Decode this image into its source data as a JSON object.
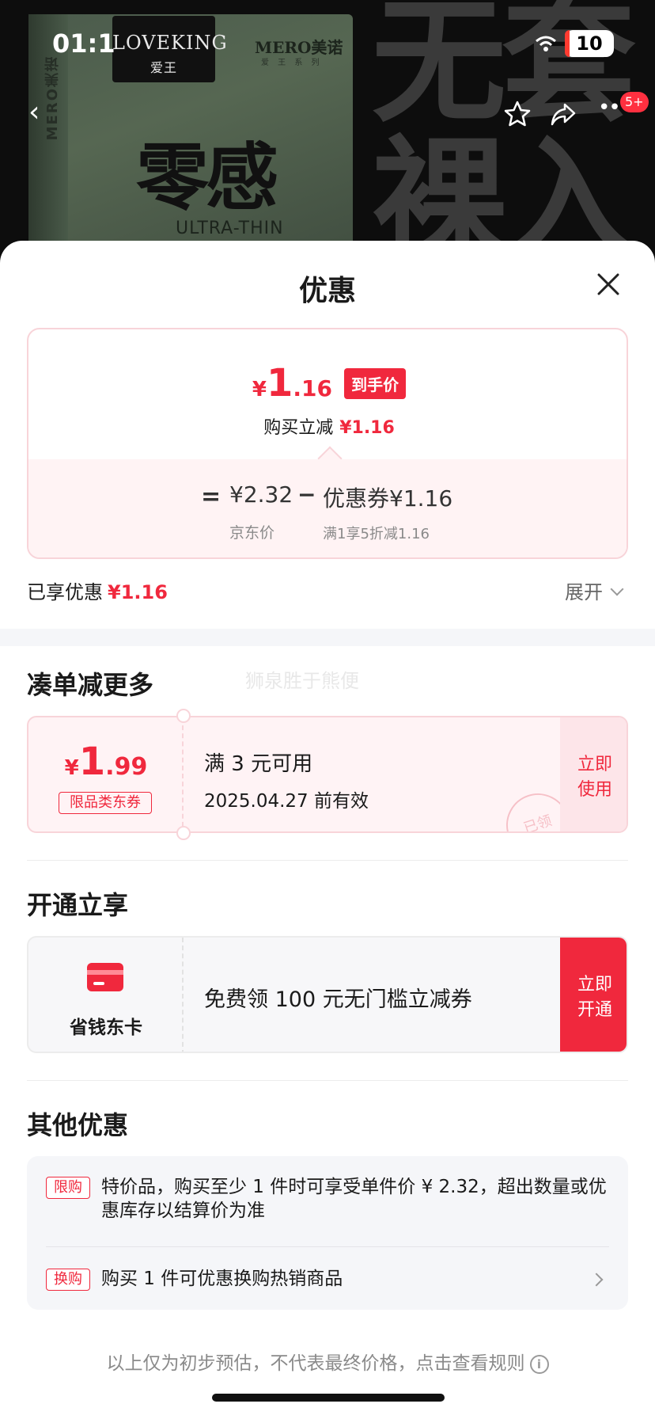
{
  "background": {
    "brand_badge_top": "LOVEKING",
    "brand_badge_bottom": "爱王",
    "mero_brand": "MERO美诺",
    "mero_sub": "爱 王 系 列",
    "product_name": "零感",
    "product_en": "ULTRA-THIN",
    "side_text": "MERO美诺",
    "overlay_line1": "无套",
    "overlay_line2": "裸入"
  },
  "status_bar": {
    "time": "01:1",
    "battery": "10"
  },
  "top_nav": {
    "more_badge": "5+"
  },
  "sheet": {
    "title": "优惠"
  },
  "price_card": {
    "final_currency": "¥",
    "final_int": "1",
    "final_dec": ".16",
    "final_tag": "到手价",
    "buy_reduce_label": "购买立减",
    "buy_reduce_amount": "¥1.16",
    "equals": "=",
    "jd_price": "¥2.32",
    "minus": "−",
    "coupon_amount": "优惠券¥1.16",
    "jd_price_label": "京东价",
    "coupon_desc": "满1享5折减1.16"
  },
  "enjoyed": {
    "label": "已享优惠",
    "amount": "¥1.16",
    "expand_label": "展开"
  },
  "section_more": {
    "title": "凑单减更多",
    "watermark": "狮泉胜于熊便",
    "coupon": {
      "currency": "¥",
      "int": "1",
      "dec": ".99",
      "tag": "限品类东券",
      "condition": "满 3 元可用",
      "valid": "2025.04.27 前有效",
      "stamp": "已领",
      "use_line1": "立即",
      "use_line2": "使用"
    }
  },
  "section_open": {
    "title": "开通立享",
    "card_name": "省钱东卡",
    "card_desc": "免费领 100 元无门槛立减券",
    "open_line1": "立即",
    "open_line2": "开通"
  },
  "section_other": {
    "title": "其他优惠",
    "items": [
      {
        "tag": "限购",
        "text": "特价品，购买至少 1 件时可享受单件价 ¥ 2.32，超出数量或优惠库存以结算价为准"
      },
      {
        "tag": "换购",
        "text": "购买 1 件可优惠换购热销商品"
      }
    ]
  },
  "footer": {
    "note": "以上仅为初步预估，不代表最终价格，点击查看规则",
    "info_symbol": "i"
  },
  "colors": {
    "accent": "#f0283d",
    "coupon_bg": "#fff3f5",
    "muted": "#8a8a8a"
  }
}
